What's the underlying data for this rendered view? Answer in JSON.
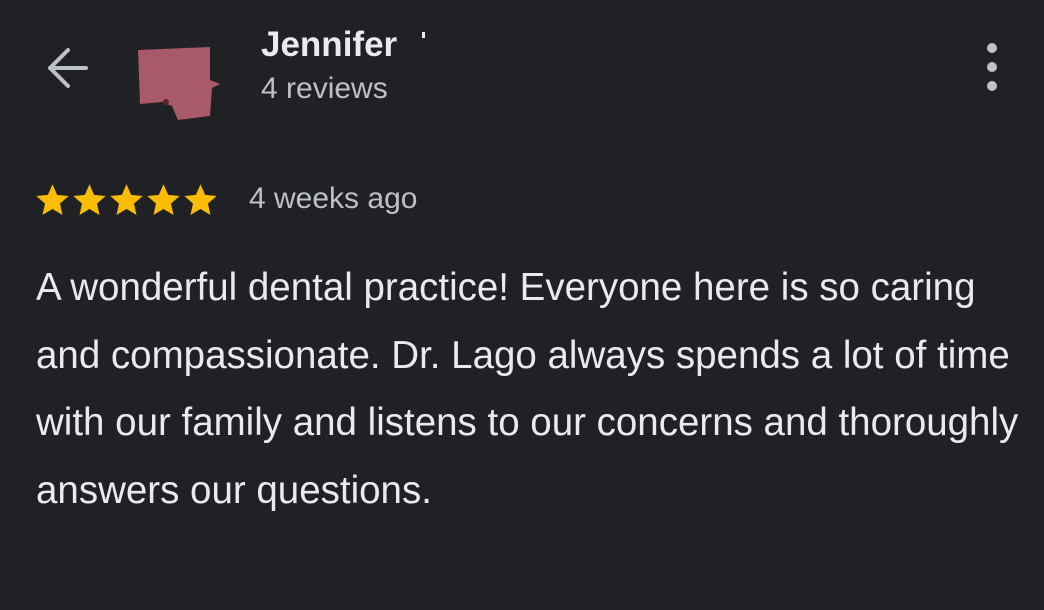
{
  "header": {
    "back_icon": "arrow-left-icon",
    "more_icon": "more-vertical-icon"
  },
  "reviewer": {
    "name": "Jennifer",
    "review_count": "4 reviews",
    "avatar_color": "#a8596a"
  },
  "review": {
    "rating": 5,
    "rating_max": 5,
    "star_color": "#fbbc04",
    "date": "4 weeks ago",
    "text": "A wonderful dental practice! Everyone here is so caring and compassionate. Dr. Lago always spends a lot of time with our family and listens to our concerns and thoroughly answers our questions."
  },
  "colors": {
    "background": "#202124",
    "primary_text": "#e8eaed",
    "secondary_text": "#bdc1c6"
  }
}
